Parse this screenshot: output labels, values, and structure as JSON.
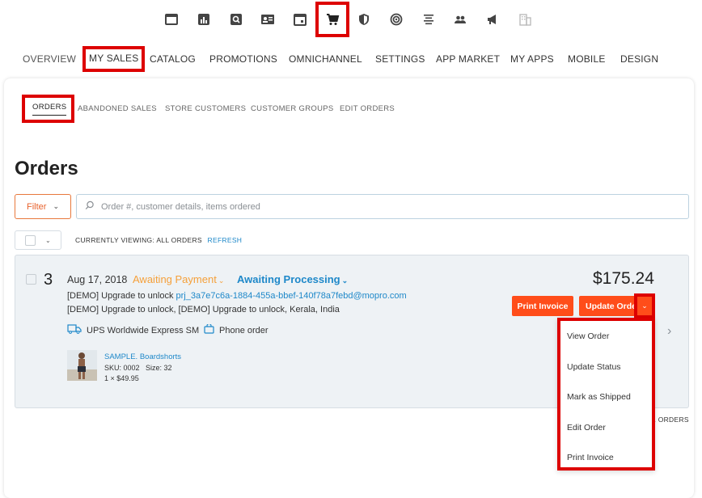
{
  "top_icons": [
    {
      "name": "window-icon"
    },
    {
      "name": "bar-chart-icon"
    },
    {
      "name": "search-box-icon"
    },
    {
      "name": "contact-card-icon"
    },
    {
      "name": "calendar-icon"
    },
    {
      "name": "shopping-cart-icon",
      "selected": true
    },
    {
      "name": "shield-icon"
    },
    {
      "name": "target-icon"
    },
    {
      "name": "align-center-icon"
    },
    {
      "name": "people-icon"
    },
    {
      "name": "megaphone-icon"
    },
    {
      "name": "building-icon"
    }
  ],
  "main_nav": [
    "OVERVIEW",
    "MY SALES",
    "CATALOG",
    "PROMOTIONS",
    "OMNICHANNEL",
    "SETTINGS",
    "APP MARKET",
    "MY APPS",
    "MOBILE",
    "DESIGN"
  ],
  "sub_nav": [
    "ORDERS",
    "ABANDONED SALES",
    "STORE CUSTOMERS",
    "CUSTOMER GROUPS",
    "EDIT ORDERS"
  ],
  "page_title": "Orders",
  "filter_label": "Filter",
  "search_placeholder": "Order #, customer details, items ordered",
  "viewing_text": "CURRENTLY VIEWING: ALL ORDERS",
  "refresh_label": "REFRESH",
  "order": {
    "number": "3",
    "date": "Aug 17, 2018",
    "payment_status": "Awaiting Payment",
    "fulfillment_status": "Awaiting Processing",
    "line1_prefix": "[DEMO] Upgrade to unlock",
    "line1_email": "prj_3a7e7c6a-1884-455a-bbef-140f78a7febd@mopro.com",
    "line2": "[DEMO] Upgrade to unlock, [DEMO] Upgrade to unlock, Kerala, India",
    "shipping": "UPS Worldwide Express SM",
    "order_source": "Phone order",
    "product_name": "SAMPLE. Boardshorts",
    "product_sku": "SKU: 0002   Size: 32",
    "product_qty": "1 × $49.95",
    "total": "$175.24",
    "print_invoice_label": "Print Invoice",
    "update_order_label": "Update Order"
  },
  "orders_count_text": "1 ORDERS",
  "dropdown": [
    "View Order",
    "Update Status",
    "Mark as Shipped",
    "Edit Order",
    "Print Invoice"
  ],
  "colors": {
    "accent_orange": "#ff4d1a",
    "link_blue": "#1e88c9",
    "awaiting_payment": "#f5a03a",
    "highlight_red": "#dd0000"
  }
}
